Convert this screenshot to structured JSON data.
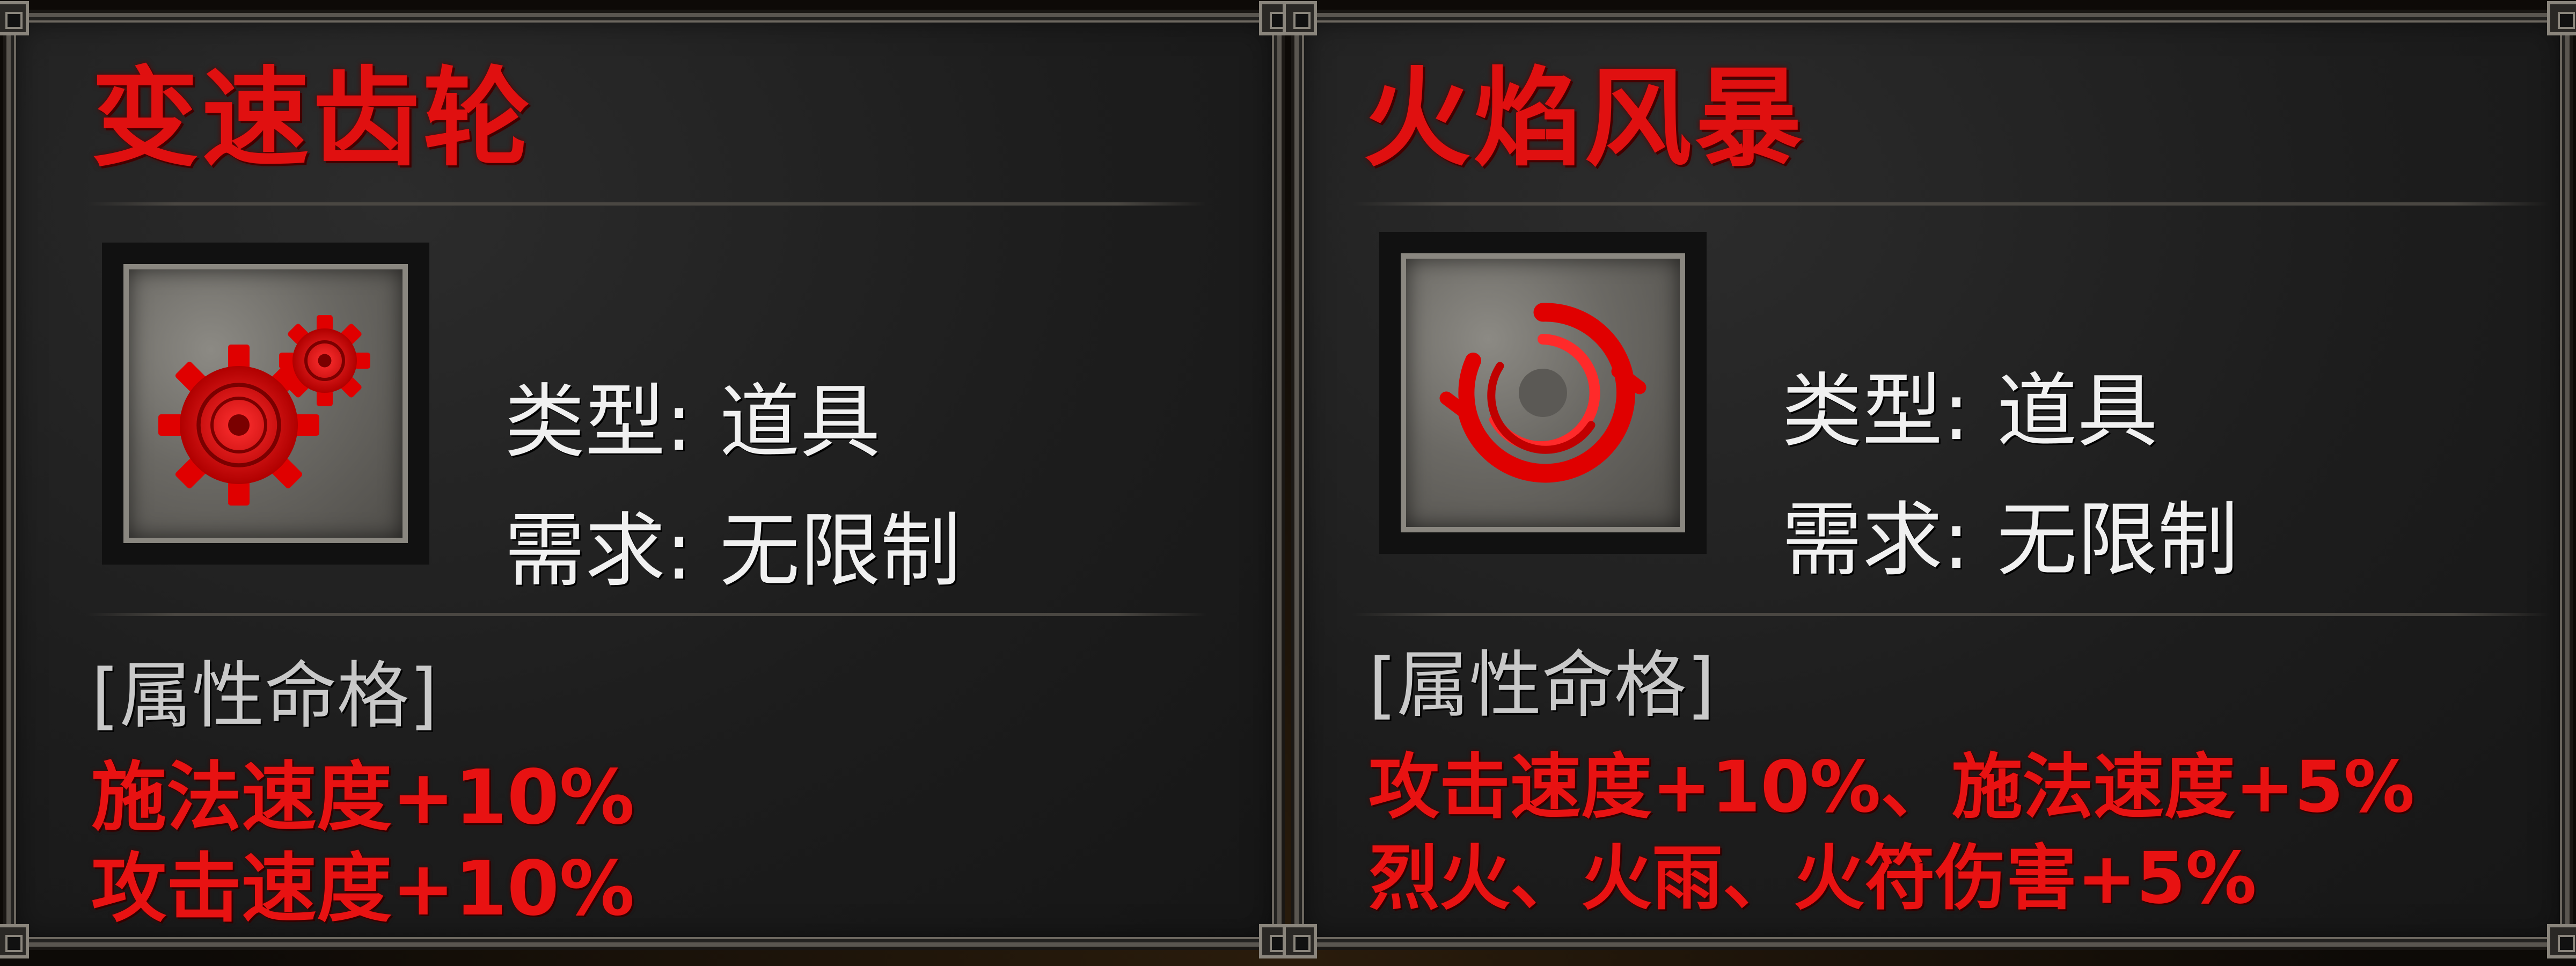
{
  "accent_color": "#e01010",
  "tooltips": [
    {
      "title": "变速齿轮",
      "icon": "red-gears-icon",
      "type_label": "类型:",
      "type_value": "道具",
      "requirement_label": "需求:",
      "requirement_value": "无限制",
      "attribute_header": "[属性命格]",
      "attributes": [
        "施法速度+10%",
        "攻击速度+10%"
      ]
    },
    {
      "title": "火焰风暴",
      "icon": "red-swirl-icon",
      "type_label": "类型:",
      "type_value": "道具",
      "requirement_label": "需求:",
      "requirement_value": "无限制",
      "attribute_header": "[属性命格]",
      "attributes": [
        "攻击速度+10%、施法速度+5%",
        "烈火、火雨、火符伤害+5%"
      ]
    }
  ]
}
